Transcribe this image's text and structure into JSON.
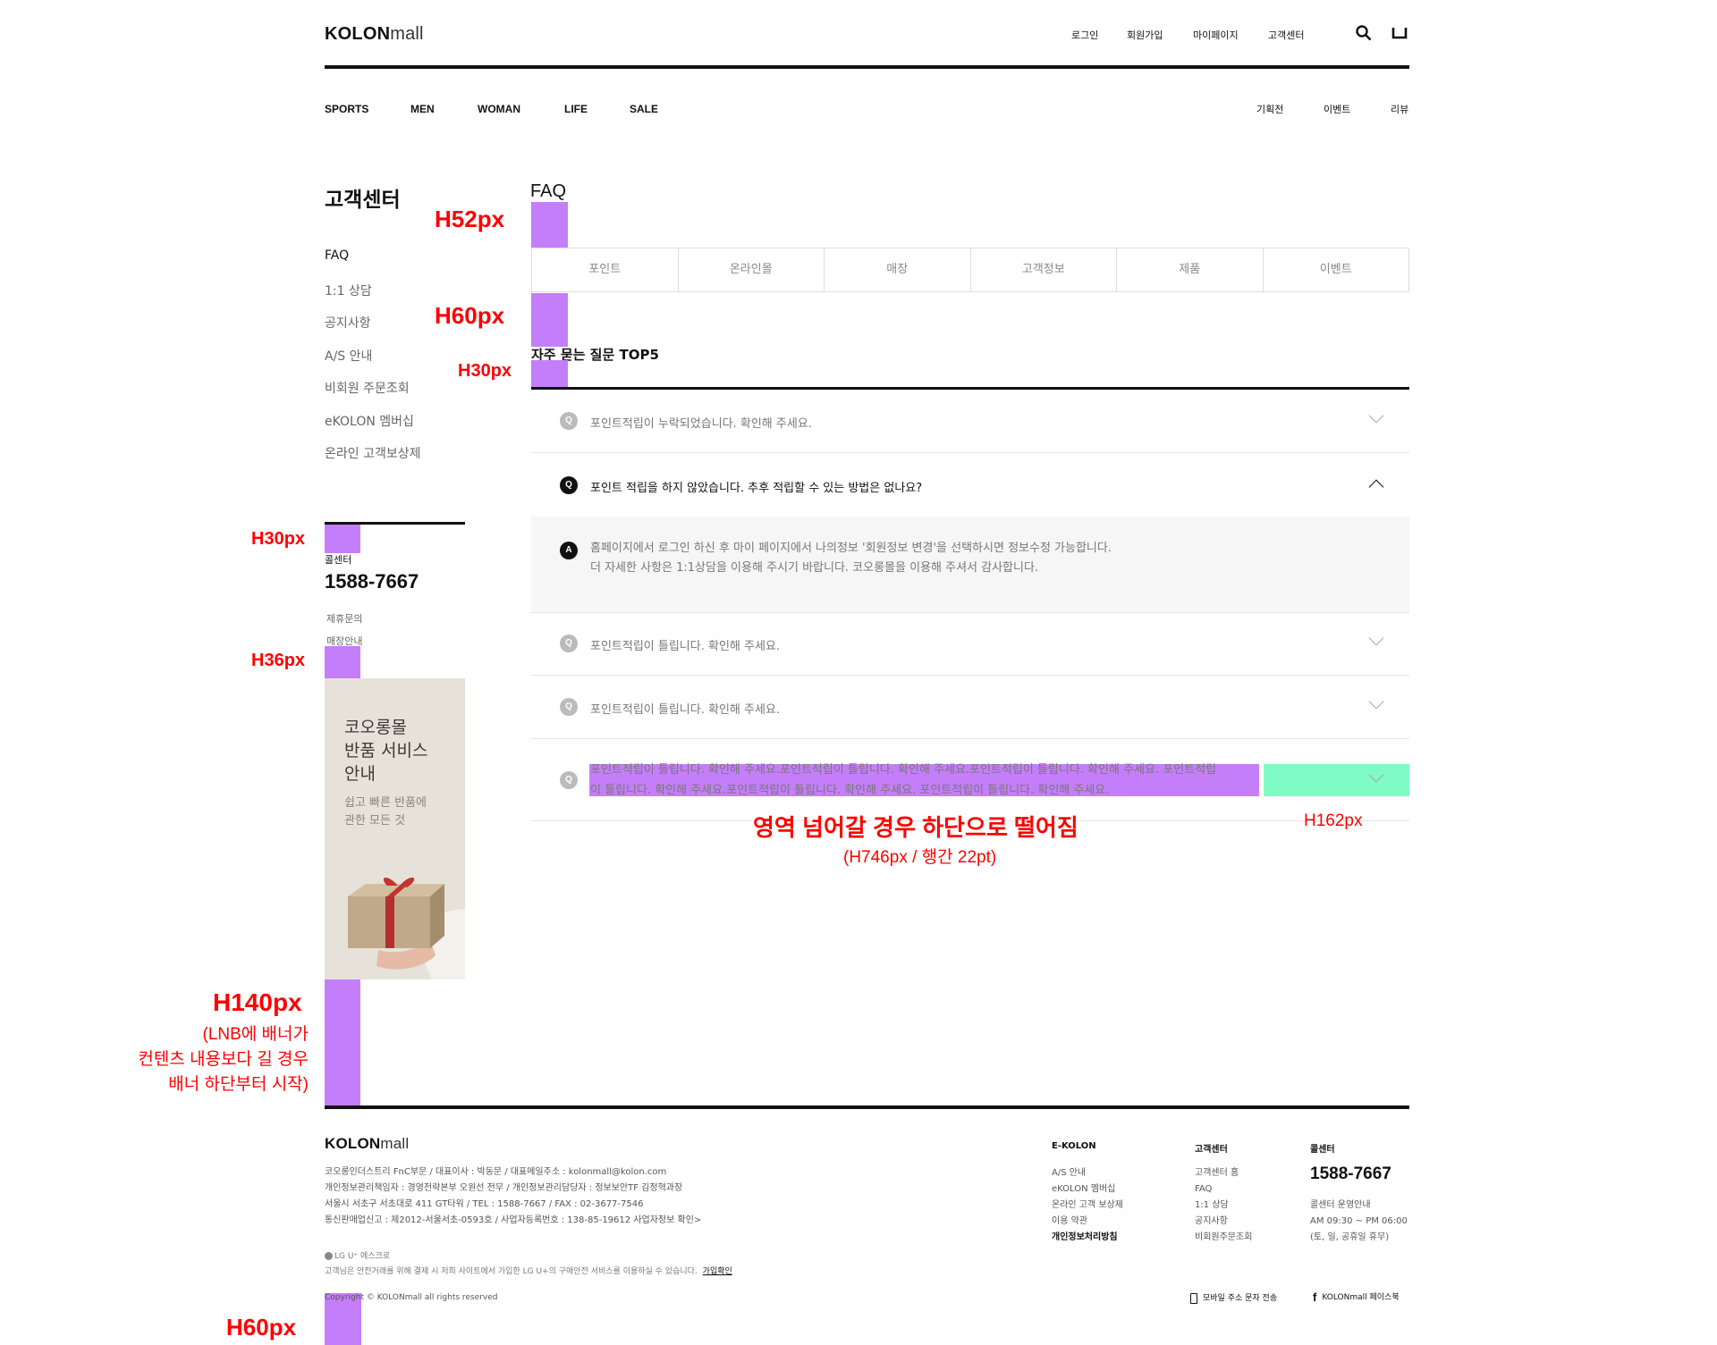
{
  "header": {
    "logo_bold": "KOLON",
    "logo_light": "mall",
    "util": [
      "로그인",
      "회원가입",
      "마이페이지",
      "고객센터"
    ],
    "gnb_left": [
      "SPORTS",
      "MEN",
      "WOMAN",
      "LIFE",
      "SALE"
    ],
    "gnb_right": [
      "기획전",
      "이벤트",
      "리뷰"
    ]
  },
  "lnb": {
    "title": "고객센터",
    "items": [
      "FAQ",
      "1:1 상담",
      "공지사항",
      "A/S 안내",
      "비회원 주문조회",
      "eKOLON 멤버십",
      "온라인 고객보상제"
    ],
    "callcenter_label": "콜센터",
    "phone": "1588-7667",
    "links": [
      "제휴문의",
      "매장안내"
    ],
    "banner": {
      "title_lines": [
        "코오롱몰",
        "반품 서비스",
        "안내"
      ],
      "sub_lines": [
        "쉽고 빠른 반품에",
        "관한 모든 것"
      ]
    }
  },
  "faq": {
    "title": "FAQ",
    "tabs": [
      "포인트",
      "온라인몰",
      "매장",
      "고객정보",
      "제품",
      "이벤트"
    ],
    "top5_title": "자주 묻는 질문 TOP5",
    "q_badge": "Q",
    "a_badge": "A",
    "q1": "포인트적립이 누락되었습니다. 확인해 주세요.",
    "q2": "포인트 적립을 하지 않았습니다. 추후 적립할 수 있는 방법은 없나요?",
    "a2_line1": "홈페이지에서 로그인 하신 후 마이 페이지에서 나의정보 '회원정보 변경'을 선택하시면 정보수정 가능합니다.",
    "a2_line2": "더 자세한 사항은 1:1상담을 이용해 주시기 바랍니다. 코오롱몰을 이용해 주셔서 감사합니다.",
    "q3": "포인트적립이 틀립니다. 확인해 주세요.",
    "q4": "포인트적립이 틀립니다. 확인해 주세요.",
    "q5_line1": "포인트적립이 틀립니다. 확인해 주세요.포인트적립이 틀립니다. 확인해 주세요.포인트적립이 틀립니다. 확인해 주세요. 포인트적립",
    "q5_line2": "이 틀립니다. 확인해 주세요.포인트적립이 틀립니다. 확인해 주세요. 포인트적립이 틀립니다. 확인해 주세요."
  },
  "annotations": {
    "h52": "H52px",
    "h60": "H60px",
    "h30a": "H30px",
    "h30b": "H30px",
    "h36": "H36px",
    "h140": "H140px",
    "h140_note": [
      "(LNB에 배너가",
      "컨텐츠 내용보다 길 경우",
      "배너 하단부터 시작)"
    ],
    "overflow_note": "영역 넘어갈 경우 하단으로 떨어짐",
    "overflow_sub": "(H746px / 행간 22pt)",
    "h162": "H162px",
    "h60_footer": "H60px"
  },
  "footer": {
    "logo_bold": "KOLON",
    "logo_light": "mall",
    "info_lines": [
      "코오롱인더스트리 FnC부문 / 대표이사 : 박동문 / 대표메일주소 : kolonmall@kolon.com",
      "개인정보관리책임자 : 경영전략본부 오원선 전무 / 개인정보관리담당자 : 정보보안TF 김정혁과장",
      "서울시 서초구 서초대로 411 GT타워 / TEL : 1588-7667 / FAX : 02-3677-7546",
      "통신판매업신고 : 제2012-서울서초-0593호 / 사업자등록번호 : 138-85-19612  사업자정보 확인>"
    ],
    "lgu_label": "LG U⁺ 에스크로",
    "escrow_text": "고객님은 안전거래를 위해 결제 시 저희 사이트에서 가입한 LG U+의 구매안전 서비스를 이용하실 수 있습니다.",
    "escrow_link": "가입확인",
    "copyright": "Copyright © KOLONmall all rights reserved",
    "col1": {
      "head": "E-KOLON",
      "items": [
        "A/S 안내",
        "eKOLON 멤버십",
        "온라인 고객 보상제",
        "이용 약관",
        "개인정보처리방침"
      ]
    },
    "col2": {
      "head": "고객센터",
      "items": [
        "고객센터 홈",
        "FAQ",
        "1:1 상담",
        "공지사항",
        "비회원주문조회"
      ]
    },
    "col3": {
      "head": "콜센터",
      "phone": "1588-7667",
      "items": [
        "콜센터 운영안내",
        "AM 09:30 ~ PM 06:00",
        "(토, 일, 공휴일 휴무)"
      ]
    },
    "mobile_label": "모바일 주소 문자 전송",
    "facebook_label": "KOLONmall 페이스북"
  },
  "colors": {
    "spec_purple": "#c57ef9",
    "spec_green": "#7ffbc6",
    "annotation_red": "#ff0000"
  }
}
